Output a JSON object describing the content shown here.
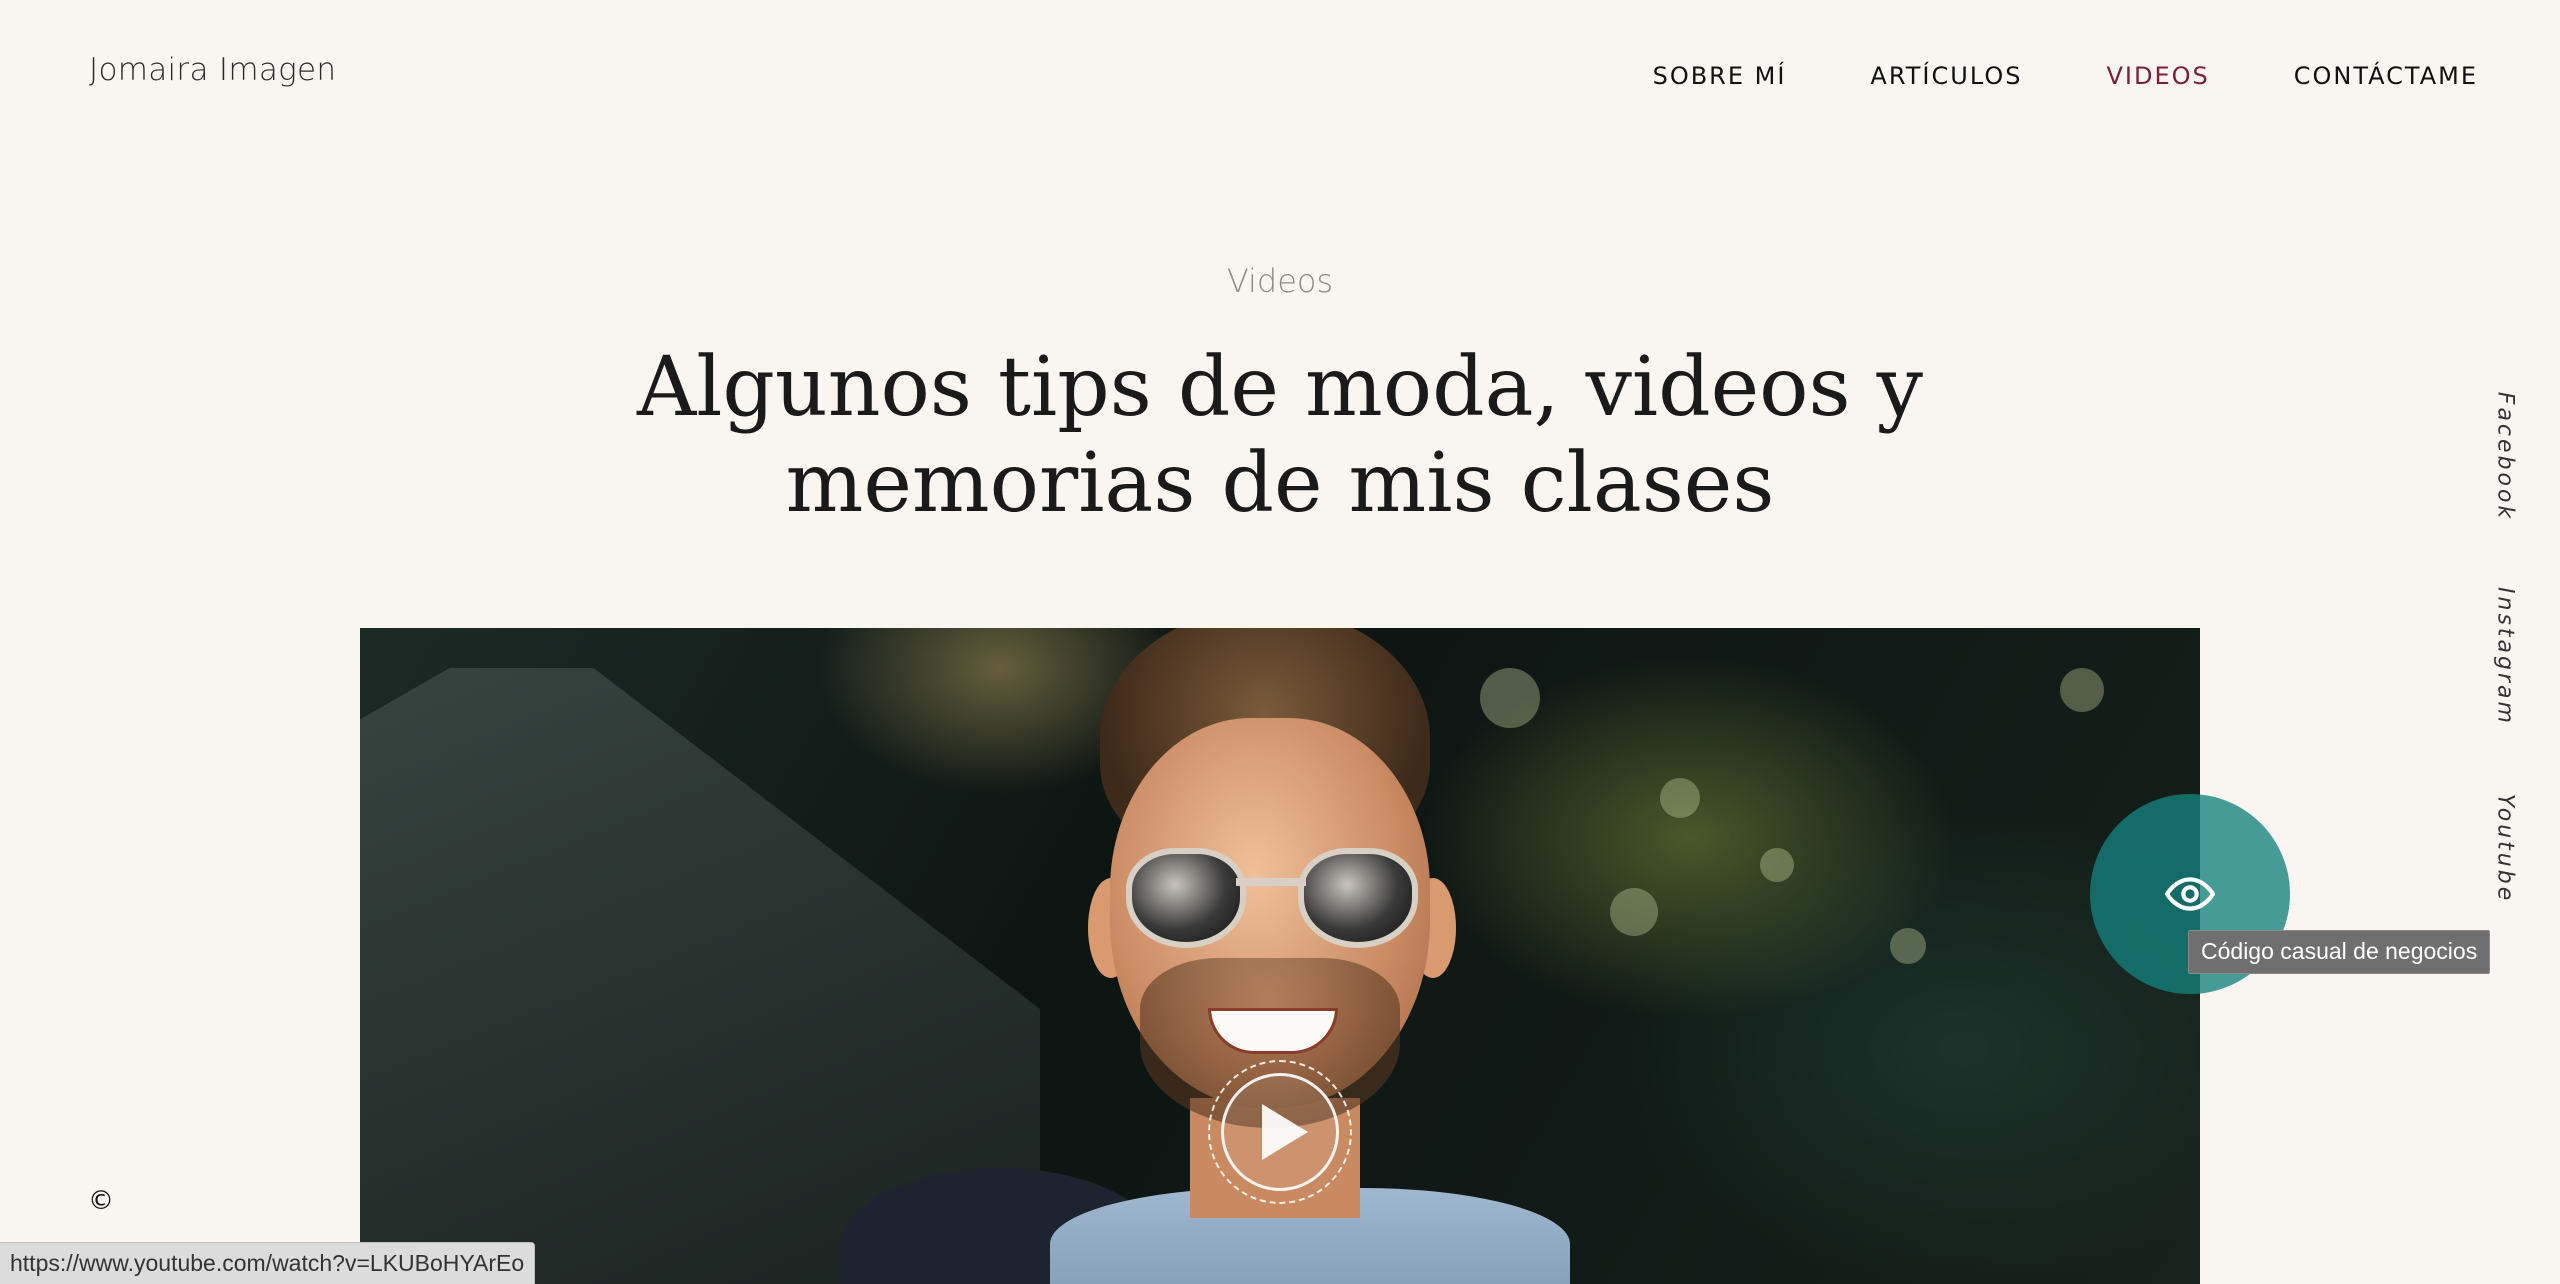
{
  "header": {
    "logo": "Jomaira Imagen",
    "nav": [
      {
        "label": "SOBRE MÍ"
      },
      {
        "label": "ARTÍCULOS"
      },
      {
        "label": "VIDEOS"
      },
      {
        "label": "CONTÁCTAME"
      }
    ],
    "active_nav": "VIDEOS"
  },
  "hero": {
    "eyebrow": "Videos",
    "headline_line1": "Algunos tips de moda, videos y",
    "headline_line2": "memorias de mis clases"
  },
  "social": {
    "facebook": "Facebook",
    "instagram": "Instagram",
    "youtube": "Youtube"
  },
  "video": {
    "play_icon": "play-icon"
  },
  "view_bubble": {
    "icon": "eye-icon",
    "tooltip": "Código casual de negocios"
  },
  "footer": {
    "copyright": "©"
  },
  "status_bar": {
    "url": "https://www.youtube.com/watch?v=LKUBoHYArEo"
  },
  "colors": {
    "background": "#f9f5f0",
    "active_nav": "#7a1f36",
    "accent_teal": "#14827d"
  }
}
